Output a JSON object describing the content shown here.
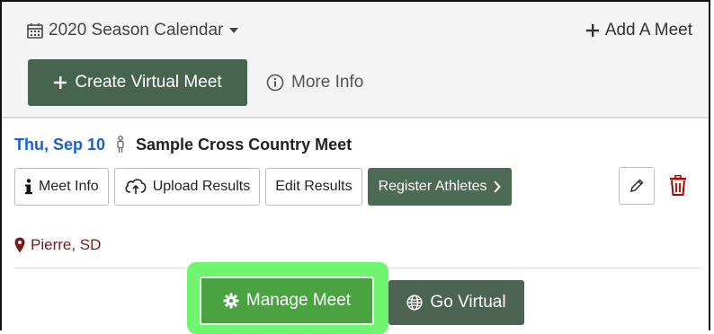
{
  "header": {
    "season_label": "2020 Season Calendar",
    "add_meet_label": "Add A Meet",
    "create_virtual_label": "Create Virtual Meet",
    "more_info_label": "More Info"
  },
  "meet": {
    "date": "Thu, Sep 10",
    "name": "Sample Cross Country Meet",
    "buttons": {
      "meet_info": "Meet Info",
      "upload_results": "Upload Results",
      "edit_results": "Edit Results",
      "register_athletes": "Register Athletes"
    },
    "location": "Pierre, SD",
    "manage_label": "Manage Meet",
    "virtual_label": "Go Virtual"
  },
  "colors": {
    "accent_green": "#476451",
    "manage_green": "#4aa340",
    "highlight": "#6ff56f",
    "date_blue": "#1a5fd0",
    "location_red": "#7a1a1a",
    "trash_red": "#b00000"
  }
}
